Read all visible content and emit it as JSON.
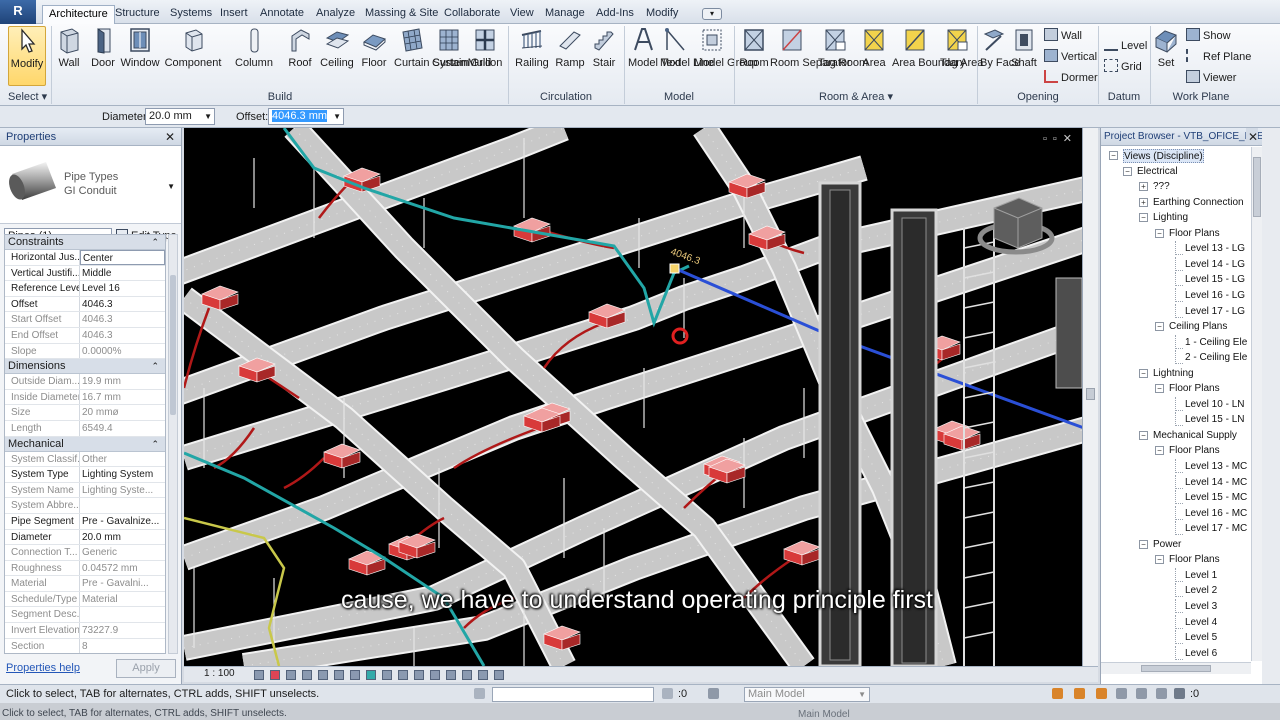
{
  "tabs": [
    "Architecture",
    "Structure",
    "Systems",
    "Insert",
    "Annotate",
    "Analyze",
    "Massing & Site",
    "Collaborate",
    "View",
    "Manage",
    "Add-Ins",
    "Modify"
  ],
  "ribbon": {
    "modify": "Modify",
    "build": [
      "Wall",
      "Door",
      "Window",
      "Component",
      "Column",
      "Roof",
      "Ceiling",
      "Floor",
      "Curtain System",
      "Curtain Grid",
      "Mullion"
    ],
    "circulation": [
      "Railing",
      "Ramp",
      "Stair"
    ],
    "model": [
      "Model Text",
      "Model Line",
      "Model Group"
    ],
    "room_area": [
      "Room",
      "Room Separator",
      "Tag Room",
      "Area",
      "Area Boundary",
      "Tag Area"
    ],
    "opening_big": [
      "By Face",
      "Shaft"
    ],
    "opening_small": [
      "Wall",
      "Vertical",
      "Dormer"
    ],
    "datum": [
      "Level",
      "Grid"
    ],
    "work_plane_big": "Set",
    "work_plane_small": [
      "Show",
      "Ref Plane",
      "Viewer"
    ],
    "panels": {
      "select": "Select",
      "build": "Build",
      "circulation": "Circulation",
      "model": "Model",
      "room_area": "Room & Area",
      "opening": "Opening",
      "datum": "Datum",
      "work_plane": "Work Plane"
    }
  },
  "options": {
    "diameter_label": "Diameter:",
    "diameter_value": "20.0 mm",
    "offset_label": "Offset:",
    "offset_value": "4046.3 mm"
  },
  "properties": {
    "title": "Properties",
    "type_family": "Pipe Types",
    "type_name": "GI Conduit",
    "instance": "Pipes (1)",
    "edit_type": "Edit Type",
    "groups": [
      {
        "name": "Constraints",
        "rows": [
          {
            "n": "Horizontal Jus...",
            "v": "Center",
            "dim": false,
            "box": true
          },
          {
            "n": "Vertical Justifi...",
            "v": "Middle",
            "dim": false,
            "box": false
          },
          {
            "n": "Reference Level",
            "v": "Level 16",
            "dim": false,
            "box": false
          },
          {
            "n": "Offset",
            "v": "4046.3",
            "dim": false,
            "box": false
          },
          {
            "n": "Start Offset",
            "v": "4046.3",
            "dim": true,
            "box": false
          },
          {
            "n": "End Offset",
            "v": "4046.3",
            "dim": true,
            "box": false
          },
          {
            "n": "Slope",
            "v": "0.0000%",
            "dim": true,
            "box": false
          }
        ]
      },
      {
        "name": "Dimensions",
        "rows": [
          {
            "n": "Outside Diam...",
            "v": "19.9 mm",
            "dim": true,
            "box": false
          },
          {
            "n": "Inside Diameter",
            "v": "16.7 mm",
            "dim": true,
            "box": false
          },
          {
            "n": "Size",
            "v": "20 mmø",
            "dim": true,
            "box": false
          },
          {
            "n": "Length",
            "v": "6549.4",
            "dim": true,
            "box": false
          }
        ]
      },
      {
        "name": "Mechanical",
        "rows": [
          {
            "n": "System Classif...",
            "v": "Other",
            "dim": true,
            "box": false
          },
          {
            "n": "System Type",
            "v": "Lighting System",
            "dim": false,
            "box": false
          },
          {
            "n": "System Name",
            "v": "Lighting Syste...",
            "dim": true,
            "box": false
          },
          {
            "n": "System Abbre...",
            "v": "",
            "dim": true,
            "box": false
          },
          {
            "n": "Pipe Segment",
            "v": "Pre - Gavalnize...",
            "dim": false,
            "box": false
          },
          {
            "n": "Diameter",
            "v": "20.0 mm",
            "dim": false,
            "box": false
          },
          {
            "n": "Connection T...",
            "v": "Generic",
            "dim": true,
            "box": false
          },
          {
            "n": "Roughness",
            "v": "0.04572 mm",
            "dim": true,
            "box": false
          },
          {
            "n": "Material",
            "v": "Pre - Gavalni...",
            "dim": true,
            "box": false
          },
          {
            "n": "Schedule/Type",
            "v": "Material",
            "dim": true,
            "box": false
          },
          {
            "n": "Segment Desc...",
            "v": "",
            "dim": true,
            "box": false
          },
          {
            "n": "Invert Elevation",
            "v": "73227.9",
            "dim": true,
            "box": false
          },
          {
            "n": "Section",
            "v": "8",
            "dim": true,
            "box": false
          }
        ]
      }
    ],
    "help": "Properties help",
    "apply": "Apply"
  },
  "viewport": {
    "caption": "cause, we have to understand operating principle first",
    "dim_label": "4046.3",
    "scale": "1 : 100"
  },
  "browser": {
    "title": "Project Browser - VTB_OFICE_ELE...",
    "nodes": [
      {
        "t": "Views (Discipline)",
        "lvl": 0,
        "g": "-",
        "sel": true
      },
      {
        "t": "Electrical",
        "lvl": 1,
        "g": "-"
      },
      {
        "t": "???",
        "lvl": 2,
        "g": "+"
      },
      {
        "t": "Earthing Connection",
        "lvl": 2,
        "g": "+"
      },
      {
        "t": "Lighting",
        "lvl": 2,
        "g": "-"
      },
      {
        "t": "Floor Plans",
        "lvl": 3,
        "g": "-"
      },
      {
        "t": "Level 13 - LG",
        "lvl": 4,
        "g": ""
      },
      {
        "t": "Level 14 - LG",
        "lvl": 4,
        "g": ""
      },
      {
        "t": "Level 15 - LG",
        "lvl": 4,
        "g": ""
      },
      {
        "t": "Level 16 - LG",
        "lvl": 4,
        "g": ""
      },
      {
        "t": "Level 17 - LG",
        "lvl": 4,
        "g": ""
      },
      {
        "t": "Ceiling Plans",
        "lvl": 3,
        "g": "-"
      },
      {
        "t": "1 - Ceiling Ele",
        "lvl": 4,
        "g": ""
      },
      {
        "t": "2 - Ceiling Ele",
        "lvl": 4,
        "g": ""
      },
      {
        "t": "Lightning",
        "lvl": 2,
        "g": "-"
      },
      {
        "t": "Floor Plans",
        "lvl": 3,
        "g": "-"
      },
      {
        "t": "Level 10 - LN",
        "lvl": 4,
        "g": ""
      },
      {
        "t": "Level 15 - LN",
        "lvl": 4,
        "g": ""
      },
      {
        "t": "Mechanical Supply",
        "lvl": 2,
        "g": "-"
      },
      {
        "t": "Floor Plans",
        "lvl": 3,
        "g": "-"
      },
      {
        "t": "Level 13 - MC",
        "lvl": 4,
        "g": ""
      },
      {
        "t": "Level 14 - MC",
        "lvl": 4,
        "g": ""
      },
      {
        "t": "Level 15 - MC",
        "lvl": 4,
        "g": ""
      },
      {
        "t": "Level 16 - MC",
        "lvl": 4,
        "g": ""
      },
      {
        "t": "Level 17 - MC",
        "lvl": 4,
        "g": ""
      },
      {
        "t": "Power",
        "lvl": 2,
        "g": "-"
      },
      {
        "t": "Floor Plans",
        "lvl": 3,
        "g": "-"
      },
      {
        "t": "Level 1",
        "lvl": 4,
        "g": ""
      },
      {
        "t": "Level 2",
        "lvl": 4,
        "g": ""
      },
      {
        "t": "Level 3",
        "lvl": 4,
        "g": ""
      },
      {
        "t": "Level 4",
        "lvl": 4,
        "g": ""
      },
      {
        "t": "Level 5",
        "lvl": 4,
        "g": ""
      },
      {
        "t": "Level 6",
        "lvl": 4,
        "g": ""
      }
    ]
  },
  "status": {
    "text": "Click to select, TAB for alternates, CTRL adds, SHIFT unselects.",
    "left_count": ":0",
    "model": "Main Model",
    "right_count": ":0"
  },
  "colors": {
    "tray": "#c8c8c8",
    "tray_edge": "#f2f2f2",
    "box": "#d83a3a",
    "cable": "#b01818",
    "conduit": "#22a6a6",
    "pipe_blue": "#2a4fd6"
  }
}
